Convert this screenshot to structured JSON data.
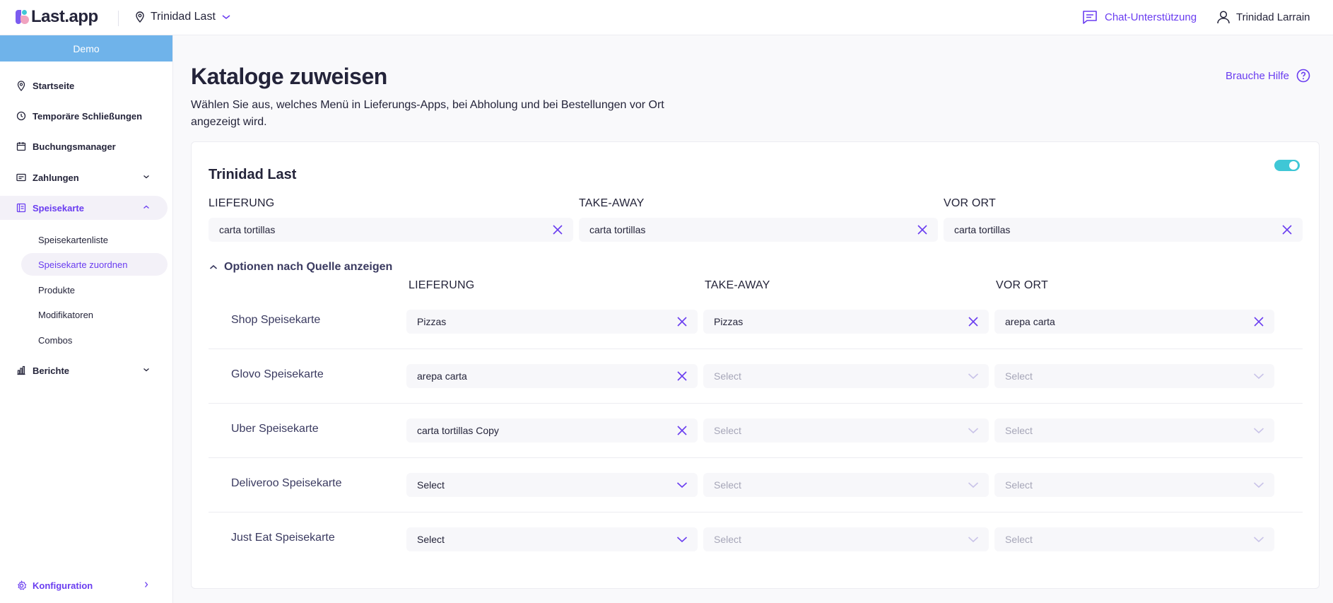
{
  "header": {
    "logo_text": "Last.app",
    "location": "Trinidad Last",
    "chat": "Chat-Unterstützung",
    "user": "Trinidad Larrain"
  },
  "sidebar": {
    "demo": "Demo",
    "items": [
      {
        "label": "Startseite",
        "icon": "location-pin-icon"
      },
      {
        "label": "Temporäre Schließungen",
        "icon": "clock-icon"
      },
      {
        "label": "Buchungsmanager",
        "icon": "calendar-icon"
      },
      {
        "label": "Zahlungen",
        "icon": "payment-icon"
      },
      {
        "label": "Speisekarte",
        "icon": "menu-icon"
      },
      {
        "label": "Berichte",
        "icon": "chart-icon"
      }
    ],
    "sub_items": [
      "Speisekartenliste",
      "Speisekarte zuordnen",
      "Produkte",
      "Modifikatoren",
      "Combos"
    ],
    "config": "Konfiguration"
  },
  "page": {
    "title": "Kataloge zuweisen",
    "description": "Wählen Sie aus, welches Menü in Lieferungs-Apps, bei Abholung und bei Bestellungen vor Ort angezeigt wird.",
    "help": "Brauche Hilfe"
  },
  "card": {
    "title": "Trinidad Last",
    "columns": [
      "LIEFERUNG",
      "TAKE-AWAY",
      "VOR ORT"
    ],
    "main_values": [
      "carta tortillas",
      "carta tortillas",
      "carta tortillas"
    ],
    "options_toggle": "Optionen nach Quelle anzeigen",
    "source_rows": [
      {
        "label": "Shop Speisekarte",
        "values": [
          "Pizzas",
          "Pizzas",
          "arepa carta"
        ]
      },
      {
        "label": "Glovo Speisekarte",
        "values": [
          "arepa carta",
          "Select",
          "Select"
        ]
      },
      {
        "label": "Uber Speisekarte",
        "values": [
          "carta tortillas Copy",
          "Select",
          "Select"
        ]
      },
      {
        "label": "Deliveroo Speisekarte",
        "values": [
          "Select",
          "Select",
          "Select"
        ]
      },
      {
        "label": "Just Eat Speisekarte",
        "values": [
          "Select",
          "Select",
          "Select"
        ]
      }
    ]
  },
  "colors": {
    "accent": "#6a3df0",
    "toggle": "#3fc7d6",
    "demo_bar": "#6fb3ea"
  }
}
